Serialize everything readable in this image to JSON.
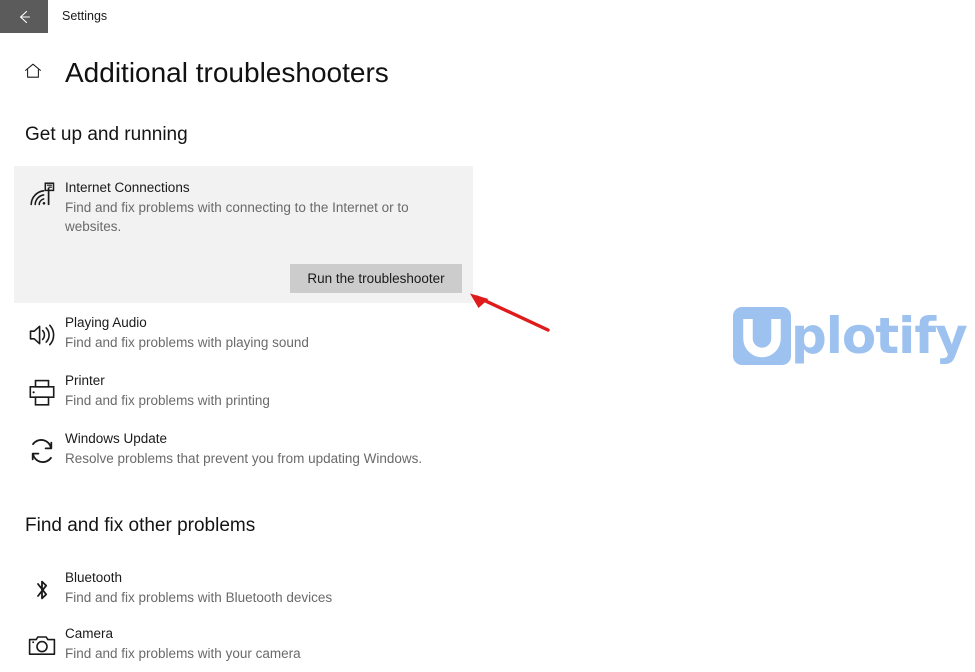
{
  "titlebar": {
    "back_icon": "arrow-left-icon",
    "title": "Settings",
    "back_button_color": "#5b5b5b"
  },
  "header": {
    "home_icon": "home-icon",
    "title": "Additional troubleshooters"
  },
  "sections": [
    {
      "heading": "Get up and running"
    },
    {
      "heading": "Find and fix other problems"
    }
  ],
  "featured": {
    "icon": "internet-connections-icon",
    "title": "Internet Connections",
    "description": "Find and fix problems with connecting to the Internet or to websites.",
    "button_label": "Run the troubleshooter",
    "card_background": "#f2f2f2",
    "button_background": "#cccccc"
  },
  "items": [
    {
      "icon": "speaker-icon",
      "title": "Playing Audio",
      "description": "Find and fix problems with playing sound"
    },
    {
      "icon": "printer-icon",
      "title": "Printer",
      "description": "Find and fix problems with printing"
    },
    {
      "icon": "refresh-icon",
      "title": "Windows Update",
      "description": "Resolve problems that prevent you from updating Windows."
    },
    {
      "icon": "bluetooth-icon",
      "title": "Bluetooth",
      "description": "Find and fix problems with Bluetooth devices"
    },
    {
      "icon": "camera-icon",
      "title": "Camera",
      "description": "Find and fix problems with your camera"
    }
  ],
  "annotation": {
    "icon": "red-arrow-icon",
    "color": "#e01b1b"
  },
  "watermark": {
    "mark": "uplotify-u-logo",
    "text": "plotify",
    "color": "#9dc2f0"
  }
}
